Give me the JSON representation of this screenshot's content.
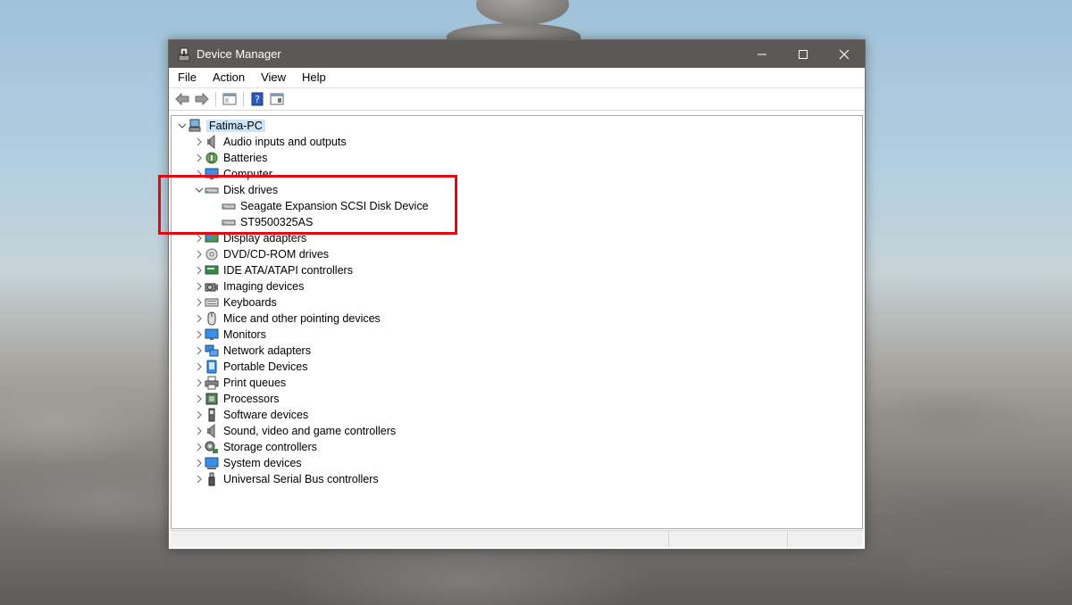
{
  "window": {
    "title": "Device Manager"
  },
  "menu": [
    "File",
    "Action",
    "View",
    "Help"
  ],
  "toolbar": {
    "buttons": [
      "back-arrow-icon",
      "forward-arrow-icon",
      "show-hide-console-tree-icon",
      "help-icon",
      "properties-icon"
    ]
  },
  "tree": {
    "root": "Fatima-PC",
    "categories": [
      {
        "label": "Audio inputs and outputs",
        "icon": "speaker-icon"
      },
      {
        "label": "Batteries",
        "icon": "battery-icon"
      },
      {
        "label": "Computer",
        "icon": "monitor-icon"
      },
      {
        "label": "Disk drives",
        "icon": "disk-drive-icon",
        "expanded": true,
        "children": [
          "Seagate Expansion SCSI Disk Device",
          "ST9500325AS"
        ]
      },
      {
        "label": "Display adapters",
        "icon": "display-adapter-icon"
      },
      {
        "label": "DVD/CD-ROM drives",
        "icon": "disc-icon"
      },
      {
        "label": "IDE ATA/ATAPI controllers",
        "icon": "controller-icon"
      },
      {
        "label": "Imaging devices",
        "icon": "camera-icon"
      },
      {
        "label": "Keyboards",
        "icon": "keyboard-icon"
      },
      {
        "label": "Mice and other pointing devices",
        "icon": "mouse-icon"
      },
      {
        "label": "Monitors",
        "icon": "monitor-icon"
      },
      {
        "label": "Network adapters",
        "icon": "network-icon"
      },
      {
        "label": "Portable Devices",
        "icon": "portable-device-icon"
      },
      {
        "label": "Print queues",
        "icon": "printer-icon"
      },
      {
        "label": "Processors",
        "icon": "processor-icon"
      },
      {
        "label": "Software devices",
        "icon": "software-device-icon"
      },
      {
        "label": "Sound, video and game controllers",
        "icon": "speaker-icon"
      },
      {
        "label": "Storage controllers",
        "icon": "storage-controller-icon"
      },
      {
        "label": "System devices",
        "icon": "system-device-icon"
      },
      {
        "label": "Universal Serial Bus controllers",
        "icon": "usb-icon"
      }
    ]
  },
  "colors": {
    "titlebar": "#5b5855",
    "selection": "#cce4f7",
    "highlight_box": "#e30613"
  }
}
